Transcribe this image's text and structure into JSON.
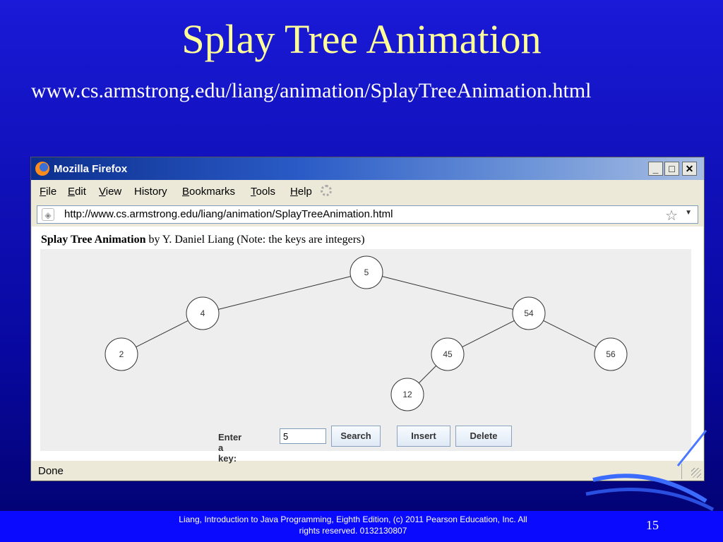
{
  "slide": {
    "title": "Splay Tree Animation",
    "url": "www.cs.armstrong.edu/liang/animation/SplayTreeAnimation.html"
  },
  "browser": {
    "window_title": "Mozilla Firefox",
    "window_buttons": {
      "minimize": "_",
      "maximize": "□",
      "close": "✕"
    },
    "menu": [
      "File",
      "Edit",
      "View",
      "History",
      "Bookmarks",
      "Tools",
      "Help"
    ],
    "menu_mnemonics": [
      "F",
      "E",
      "V",
      "s",
      "B",
      "T",
      "H"
    ],
    "address": "http://www.cs.armstrong.edu/liang/animation/SplayTreeAnimation.html",
    "status": "Done",
    "icons": [
      "firefox-logo-icon",
      "throbber-icon",
      "site-icon",
      "bookmark-star-icon",
      "dropdown-arrow-icon",
      "resize-grip-icon"
    ]
  },
  "page": {
    "heading_bold": "Splay Tree Animation",
    "heading_rest": " by Y. Daniel Liang (Note: the keys are integers)"
  },
  "applet": {
    "key_label": "Enter a key:",
    "key_value": "5",
    "buttons": {
      "search": "Search",
      "insert": "Insert",
      "delete": "Delete"
    },
    "tree": {
      "nodes": [
        {
          "id": "n5",
          "key": "5"
        },
        {
          "id": "n4",
          "key": "4"
        },
        {
          "id": "n54",
          "key": "54"
        },
        {
          "id": "n2",
          "key": "2"
        },
        {
          "id": "n45",
          "key": "45"
        },
        {
          "id": "n56",
          "key": "56"
        },
        {
          "id": "n12",
          "key": "12"
        }
      ],
      "edges": [
        [
          "n5",
          "n4"
        ],
        [
          "n5",
          "n54"
        ],
        [
          "n4",
          "n2"
        ],
        [
          "n54",
          "n45"
        ],
        [
          "n54",
          "n56"
        ],
        [
          "n45",
          "n12"
        ]
      ]
    }
  },
  "footer": {
    "line1": "Liang, Introduction to Java Programming, Eighth Edition, (c) 2011 Pearson Education, Inc. All",
    "line2": "rights reserved. 0132130807",
    "page_number": "15"
  },
  "colors": {
    "slide_background": "#0b0bb0",
    "title": "#ffff99",
    "footer_bar": "#0a0aff",
    "applet_background": "#eeeeee"
  }
}
